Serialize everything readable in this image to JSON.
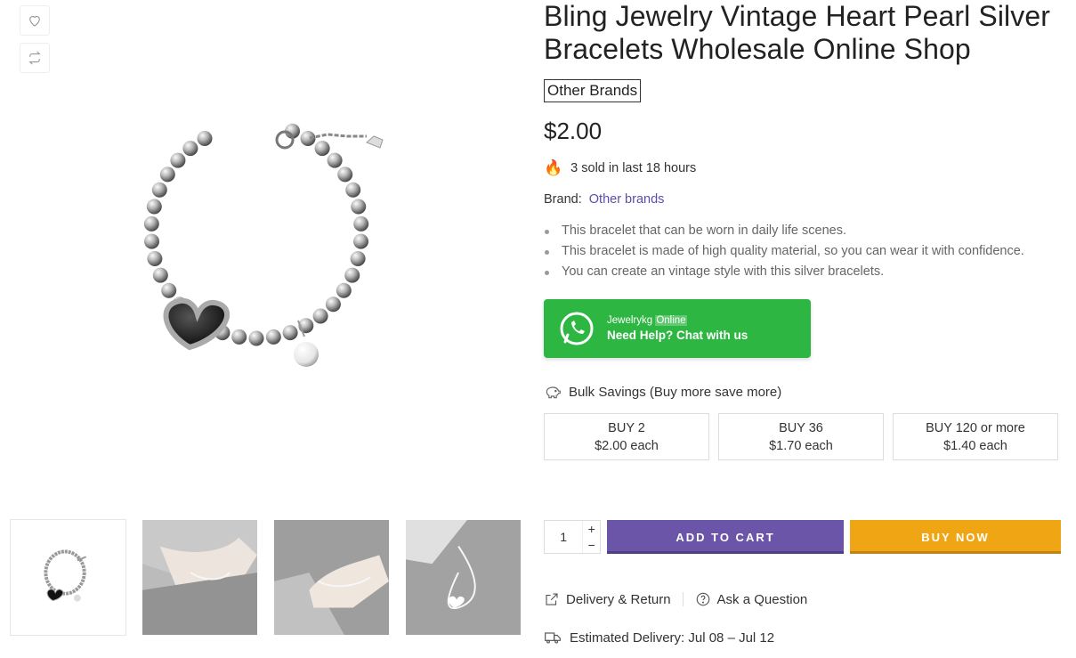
{
  "product": {
    "title": "Bling Jewelry Vintage Heart Pearl Silver Bracelets Wholesale Online Shop",
    "brand_tag": "Other Brands",
    "price": "$2.00",
    "sold_text": "3 sold in last 18 hours",
    "brand_label": "Brand:",
    "brand_value": "Other brands",
    "bullets": [
      "This bracelet that can be worn in daily life scenes.",
      "This bracelet is made of high quality material, so you can wear it with confidence.",
      "You can create an vintage style with this silver bracelets."
    ]
  },
  "whatsapp": {
    "name": "Jewelrykg",
    "status": "Online",
    "cta": "Need Help? Chat with us",
    "color": "#2db742"
  },
  "bulk": {
    "heading": "Bulk Savings (Buy more save more)",
    "tiers": [
      {
        "qty": "BUY 2",
        "price": "$2.00 each"
      },
      {
        "qty": "BUY 36",
        "price": "$1.70 each"
      },
      {
        "qty": "BUY 120 or more",
        "price": "$1.40 each"
      }
    ]
  },
  "cart": {
    "quantity": "1",
    "plus": "+",
    "minus": "−",
    "add_to_cart": "ADD TO CART",
    "buy_now": "BUY NOW",
    "add_color": "#6a55a8",
    "buy_color": "#f0a515"
  },
  "links": {
    "delivery_return": "Delivery & Return",
    "ask_question": "Ask a Question"
  },
  "delivery": {
    "text": "Estimated Delivery: Jul 08 – Jul 12"
  },
  "icons": {
    "wishlist": "heart-icon",
    "compare": "compare-arrows-icon",
    "fire": "fire-icon",
    "bulk": "piggy-bank-icon",
    "delivery_return": "share-box-icon",
    "ask": "question-circle-icon",
    "truck": "truck-icon"
  }
}
